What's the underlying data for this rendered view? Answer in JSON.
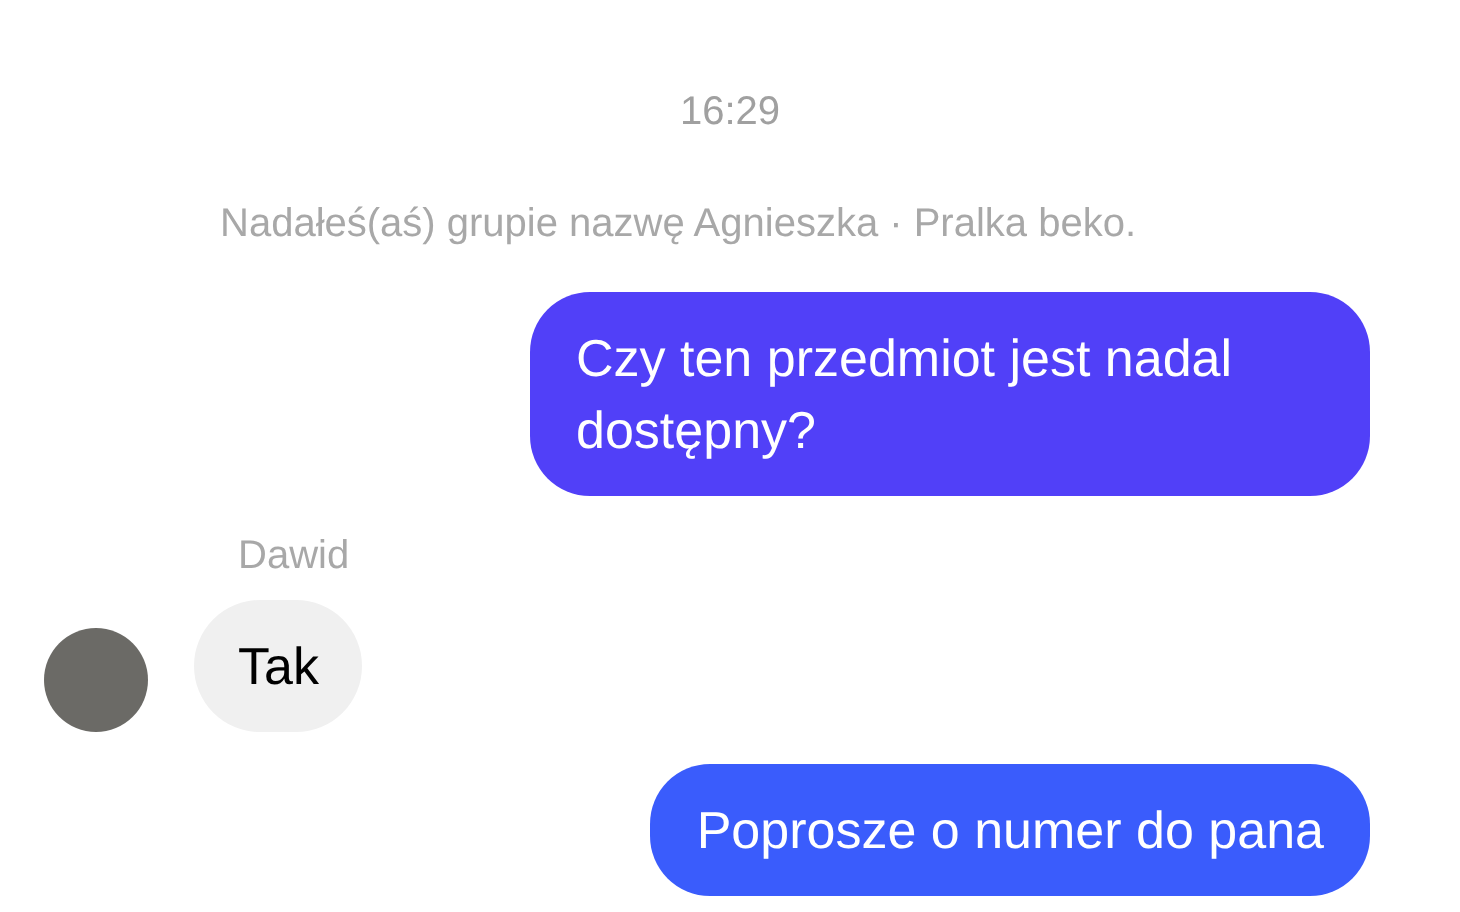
{
  "timestamp": "16:29",
  "system_notice": "Nadałeś(aś) grupie nazwę Agnieszka · Pralka beko.",
  "messages": [
    {
      "kind": "outgoing",
      "text": "Czy ten przedmiot jest nadal dostępny?",
      "color": "#5140f8"
    },
    {
      "kind": "incoming",
      "sender": "Dawid",
      "text": "Tak"
    },
    {
      "kind": "outgoing",
      "text": "Poprosze o numer do pana",
      "color": "#3a5cfc"
    }
  ]
}
